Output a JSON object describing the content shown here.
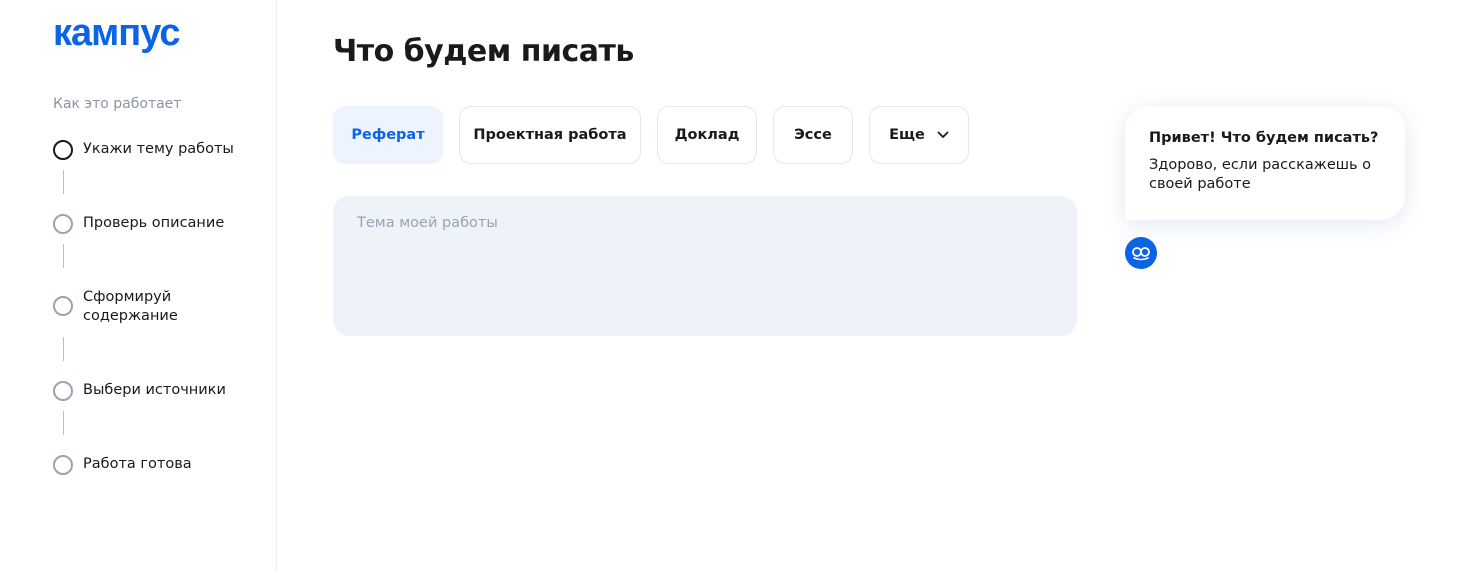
{
  "logo": {
    "text": "кампус"
  },
  "sidebar": {
    "heading": "Как это работает",
    "steps": [
      {
        "label": "Укажи тему работы",
        "active": true
      },
      {
        "label": "Проверь описание",
        "active": false
      },
      {
        "label": "Сформируй содержание",
        "active": false
      },
      {
        "label": "Выбери источники",
        "active": false
      },
      {
        "label": "Работа готова",
        "active": false
      }
    ]
  },
  "main": {
    "title": "Что будем писать",
    "types": [
      {
        "label": "Реферат",
        "selected": true
      },
      {
        "label": "Проектная работа",
        "selected": false
      },
      {
        "label": "Доклад",
        "selected": false
      },
      {
        "label": "Эссе",
        "selected": false
      },
      {
        "label": "Еще",
        "selected": false
      }
    ],
    "topic_placeholder": "Тема моей работы"
  },
  "assistant": {
    "greeting": "Привет! Что будем писать?",
    "message": "Здорово, если расскажешь о своей работе",
    "avatar_icon": "bot-icon"
  },
  "colors": {
    "accent": "#0b63e5",
    "chip_selected_bg": "#eef4fd",
    "input_bg": "#eef3fa"
  }
}
